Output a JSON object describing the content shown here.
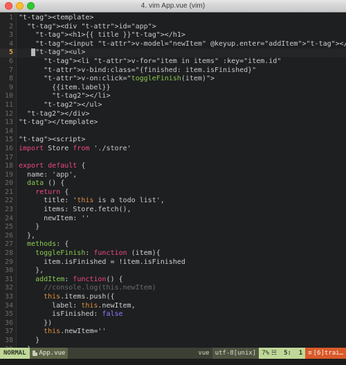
{
  "window": {
    "title": "4. vim App.vue (vim)",
    "controls": [
      "close-button",
      "minimize-button",
      "zoom-button"
    ]
  },
  "editor": {
    "current_line": 5,
    "total_visible_lines": 39,
    "lines": [
      {
        "n": "1",
        "text": "<template>"
      },
      {
        "n": "2",
        "text": "  <div id=\"app\">"
      },
      {
        "n": "3",
        "text": "    <h1>{{ title }}</h1>"
      },
      {
        "n": "4",
        "text": "    <input v-model=\"newItem\" @keyup.enter=\"addItem\"></input>"
      },
      {
        "n": "5",
        "text": "    <ul>"
      },
      {
        "n": "6",
        "text": "      <li v-for=\"item in items\" :key=\"item.id\""
      },
      {
        "n": "7",
        "text": "      v-bind:class=\"{finished: item.isFinished}\""
      },
      {
        "n": "8",
        "text": "      v-on:click=\"toggleFinish(item)\">"
      },
      {
        "n": "9",
        "text": "        {{item.label}}"
      },
      {
        "n": "10",
        "text": "        </li>"
      },
      {
        "n": "11",
        "text": "      </ul>"
      },
      {
        "n": "12",
        "text": "  </div>"
      },
      {
        "n": "13",
        "text": "</template>"
      },
      {
        "n": "14",
        "text": ""
      },
      {
        "n": "15",
        "text": "<script>"
      },
      {
        "n": "16",
        "text": "import Store from './store'"
      },
      {
        "n": "17",
        "text": ""
      },
      {
        "n": "18",
        "text": "export default {"
      },
      {
        "n": "19",
        "text": "  name: 'app',"
      },
      {
        "n": "20",
        "text": "  data () {"
      },
      {
        "n": "21",
        "text": "    return {"
      },
      {
        "n": "22",
        "text": "      title: 'this is a todo list',"
      },
      {
        "n": "23",
        "text": "      items: Store.fetch(),"
      },
      {
        "n": "24",
        "text": "      newItem: ''"
      },
      {
        "n": "25",
        "text": "    }"
      },
      {
        "n": "26",
        "text": "  },"
      },
      {
        "n": "27",
        "text": "  methods: {"
      },
      {
        "n": "28",
        "text": "    toggleFinish: function (item){"
      },
      {
        "n": "29",
        "text": "      item.isFinished = !item.isFinished"
      },
      {
        "n": "30",
        "text": "    },"
      },
      {
        "n": "31",
        "text": "    addItem: function() {"
      },
      {
        "n": "32",
        "text": "      //console.log(this.newItem)"
      },
      {
        "n": "33",
        "text": "      this.items.push({"
      },
      {
        "n": "34",
        "text": "        label: this.newItem,"
      },
      {
        "n": "35",
        "text": "        isFinished: false"
      },
      {
        "n": "36",
        "text": "      })"
      },
      {
        "n": "37",
        "text": "      this.newItem=''"
      },
      {
        "n": "38",
        "text": "    }"
      },
      {
        "n": "39",
        "text": "  },"
      }
    ]
  },
  "statusbar": {
    "mode": "NORMAL",
    "file_icon": "file-icon",
    "filename": "App.vue",
    "filetype": "vue",
    "encoding": "utf-8[unix]",
    "percent": "7%",
    "percent_icon": "☵",
    "position": "5:  1",
    "warning_icon": "≡",
    "warning": "[6]trai…"
  },
  "colors": {
    "background": "#1d1f21",
    "gutter": "#232323",
    "status_green": "#bfd898",
    "status_dark": "#3c3f34",
    "status_warn": "#d85a2a",
    "tag": "#f0487c",
    "attr": "#8cc94f",
    "this": "#e08f3c",
    "bool": "#8e7cff",
    "comment": "#6a6a6a"
  }
}
